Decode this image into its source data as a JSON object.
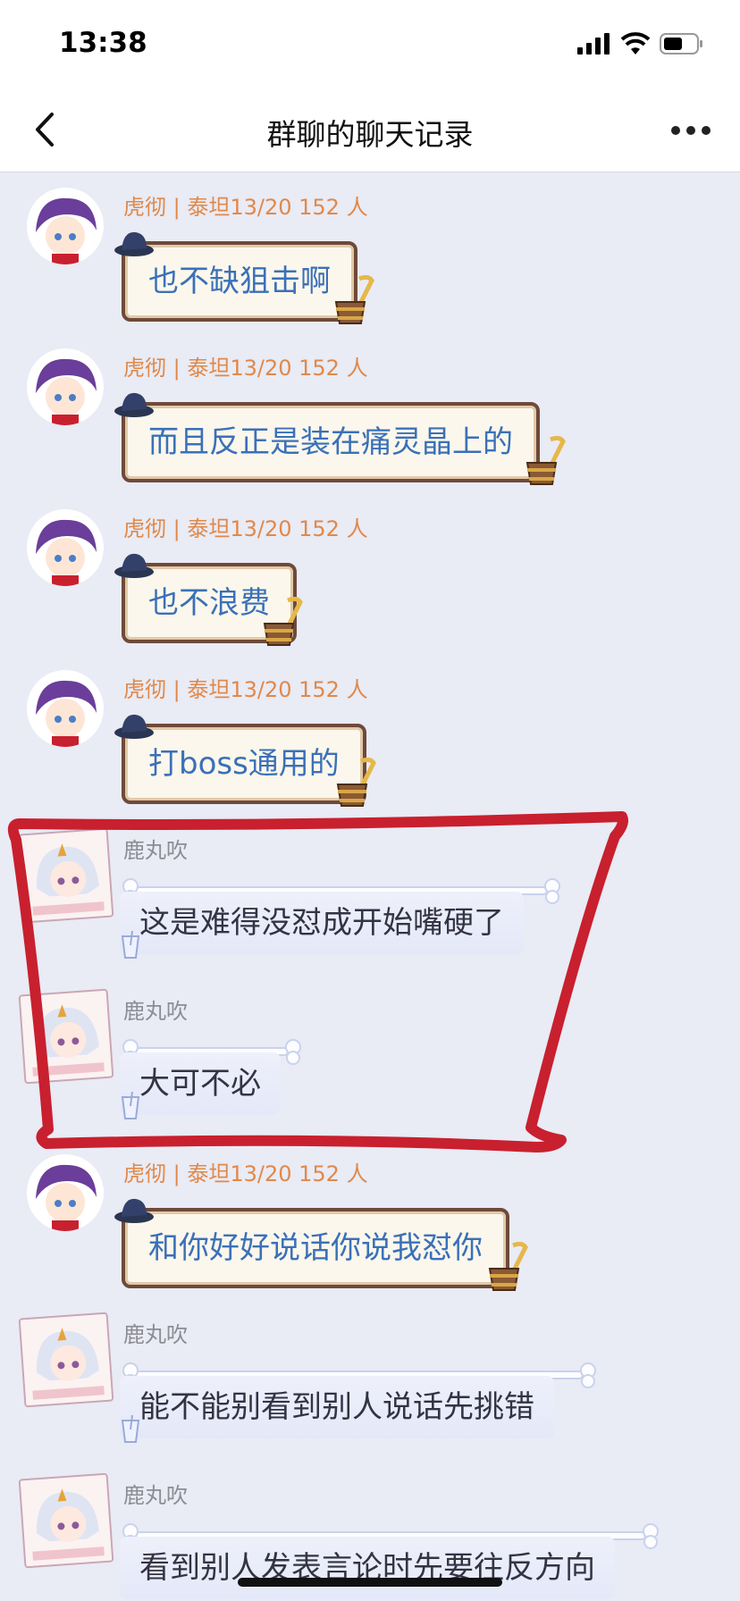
{
  "status_bar": {
    "time": "13:38"
  },
  "nav": {
    "title": "群聊的聊天记录"
  },
  "messages": [
    {
      "sender": "虎彻 | 泰坦13/20  152 人",
      "text": "也不缺狙击啊"
    },
    {
      "sender": "虎彻 | 泰坦13/20  152 人",
      "text": "而且反正是装在痛灵晶上的"
    },
    {
      "sender": "虎彻 | 泰坦13/20  152 人",
      "text": "也不浪费"
    },
    {
      "sender": "虎彻 | 泰坦13/20  152 人",
      "text": "打boss通用的"
    },
    {
      "sender": "鹿丸吹",
      "text": "这是难得没怼成开始嘴硬了"
    },
    {
      "sender": "鹿丸吹",
      "text": "大可不必"
    },
    {
      "sender": "虎彻 | 泰坦13/20  152 人",
      "text": "和你好好说话你说我怼你"
    },
    {
      "sender": "鹿丸吹",
      "text": "能不能别看到别人说话先挑错"
    },
    {
      "sender": "鹿丸吹",
      "text": "看到别人发表言论时先要往反方向"
    }
  ],
  "colors": {
    "chat_background": "#e9ebf5",
    "tiger_sender": "#e0894a",
    "tiger_text": "#3b70b8",
    "deer_sender": "#8c8c95",
    "annotation_red": "#c8202e"
  },
  "icons": {
    "back": "chevron-left-icon",
    "more": "more-dots-icon",
    "signal": "signal-icon",
    "wifi": "wifi-icon",
    "battery": "battery-icon"
  }
}
